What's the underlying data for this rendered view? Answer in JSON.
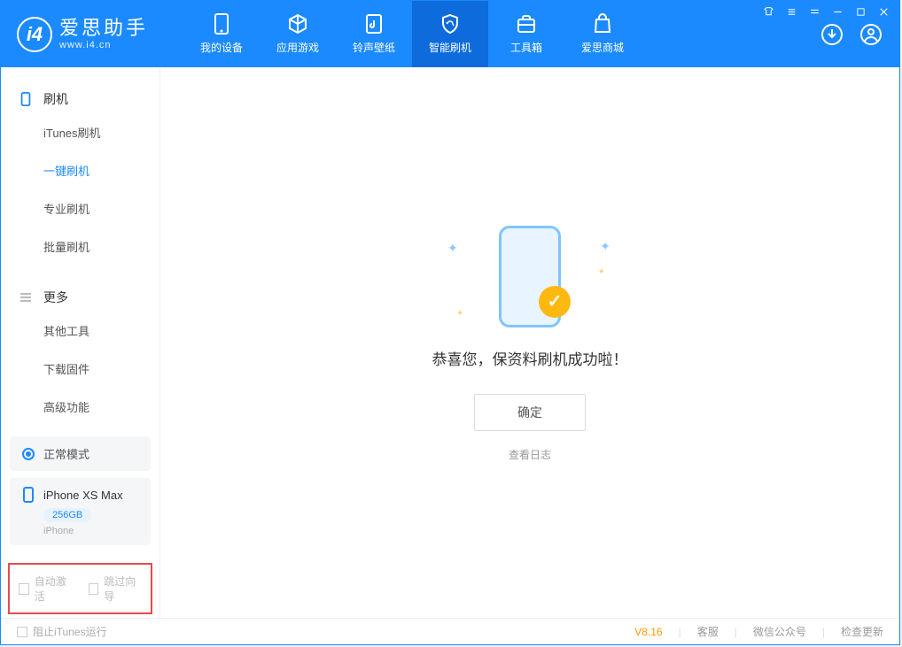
{
  "app": {
    "logo_cn": "爱思助手",
    "logo_en": "www.i4.cn"
  },
  "topnav": {
    "items": [
      {
        "label": "我的设备"
      },
      {
        "label": "应用游戏"
      },
      {
        "label": "铃声壁纸"
      },
      {
        "label": "智能刷机"
      },
      {
        "label": "工具箱"
      },
      {
        "label": "爱思商城"
      }
    ]
  },
  "sidebar": {
    "section1_title": "刷机",
    "section1_items": [
      {
        "label": "iTunes刷机"
      },
      {
        "label": "一键刷机"
      },
      {
        "label": "专业刷机"
      },
      {
        "label": "批量刷机"
      }
    ],
    "section2_title": "更多",
    "section2_items": [
      {
        "label": "其他工具"
      },
      {
        "label": "下载固件"
      },
      {
        "label": "高级功能"
      }
    ],
    "mode_label": "正常模式",
    "device_name": "iPhone XS Max",
    "device_badge": "256GB",
    "device_sub": "iPhone",
    "check_auto_activate": "自动激活",
    "check_skip_guide": "跳过向导"
  },
  "main": {
    "success_text": "恭喜您，保资料刷机成功啦！",
    "confirm_btn": "确定",
    "log_link": "查看日志"
  },
  "statusbar": {
    "block_itunes": "阻止iTunes运行",
    "version": "V8.16",
    "customer_service": "客服",
    "wechat": "微信公众号",
    "check_update": "检查更新"
  }
}
